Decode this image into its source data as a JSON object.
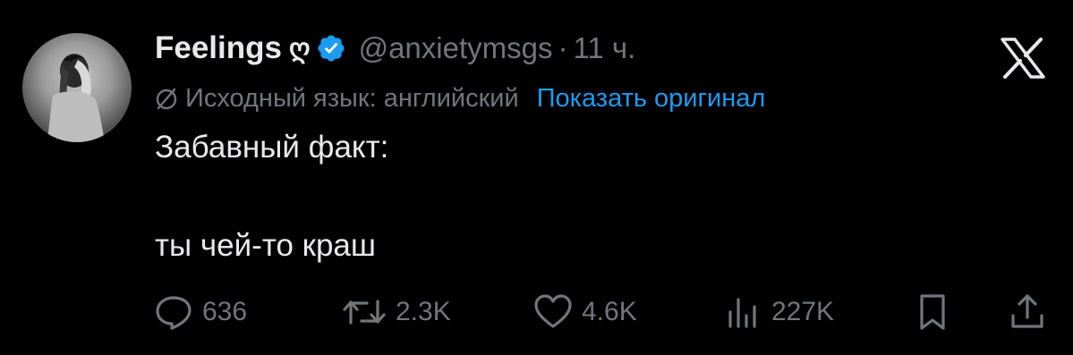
{
  "author": {
    "display_name": "Feelings",
    "name_emoji": "ღ",
    "handle": "@anxietymsgs",
    "separator": "·",
    "time": "11 ч.",
    "verified_color": "#1d9bf0"
  },
  "translation": {
    "source_label": "Исходный язык: английский",
    "show_original": "Показать оригинал",
    "link_color": "#1d9bf0"
  },
  "body": {
    "line1": "Забавный факт:",
    "line2": "ты чей-то краш"
  },
  "actions": {
    "replies": "636",
    "reposts": "2.3K",
    "likes": "4.6K",
    "views": "227K"
  },
  "icons": {
    "reply": "reply-icon",
    "repost": "repost-icon",
    "like": "heart-icon",
    "views": "views-icon",
    "bookmark": "bookmark-icon",
    "share": "share-icon",
    "platform": "x-logo-icon",
    "verified": "verified-badge-icon",
    "translate": "globe-slash-icon"
  },
  "colors": {
    "background": "#000000",
    "text_primary": "#e7e9ea",
    "text_secondary": "#71767b",
    "accent": "#1d9bf0"
  }
}
